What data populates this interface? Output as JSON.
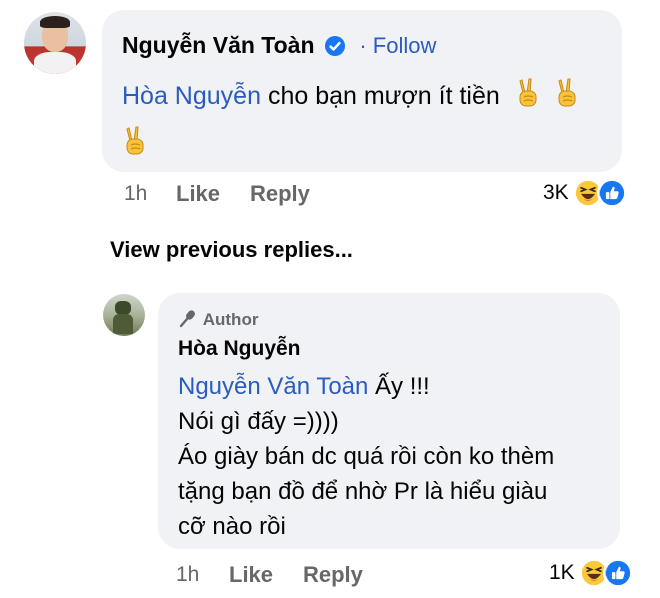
{
  "comment": {
    "author": "Nguyễn Văn Toàn",
    "follow_label": "· Follow",
    "mention": "Hòa Nguyễn",
    "text": "cho bạn mượn ít tiền",
    "time": "1h",
    "like_label": "Like",
    "reply_label": "Reply",
    "reaction_count": "3K"
  },
  "view_previous": "View previous replies...",
  "reply": {
    "badge": "Author",
    "author": "Hòa Nguyễn",
    "mention": "Nguyễn Văn Toàn",
    "line1_rest": " Ấy !!!",
    "line2": "Nói gì đấy =))))",
    "line3": "Áo giày bán dc quá rồi còn ko thèm",
    "line4": "tặng bạn đồ để nhờ Pr là hiểu giàu",
    "line5": "cỡ nào rồi",
    "time": "1h",
    "like_label": "Like",
    "reply_label": "Reply",
    "reaction_count": "1K"
  },
  "colors": {
    "link": "#2a5bbf",
    "verified": "#1877f2",
    "bubble": "#f0f2f5"
  }
}
